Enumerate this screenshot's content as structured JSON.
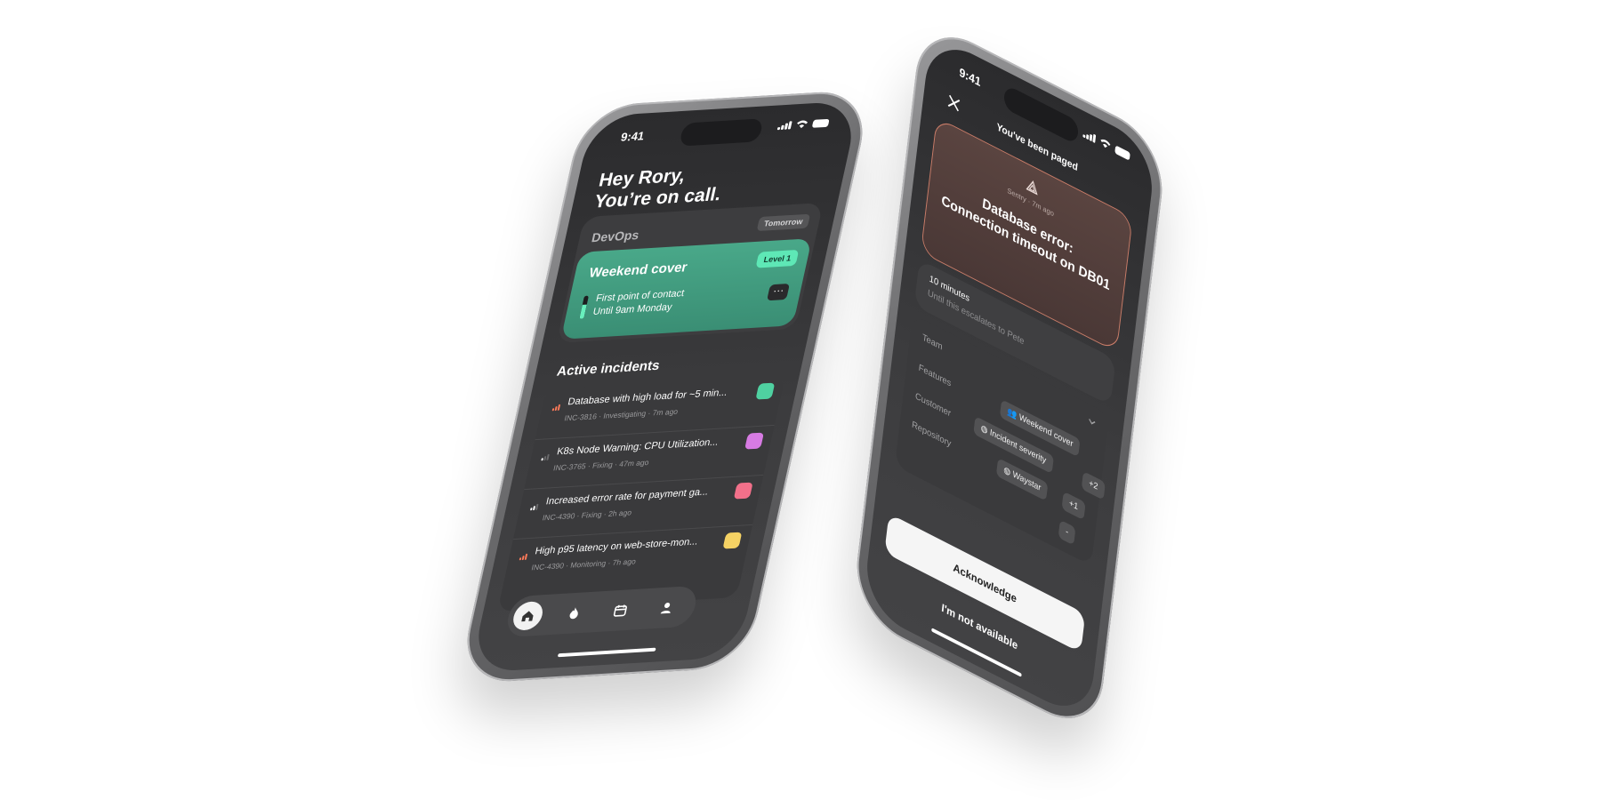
{
  "phone_one": {
    "status": {
      "time": "9:41"
    },
    "greeting": {
      "line1": "Hey Rory,",
      "line2": "You’re on call."
    },
    "team": {
      "name": "DevOps",
      "badge": "Tomorrow"
    },
    "cover": {
      "title": "Weekend cover",
      "level": "Level 1",
      "line1": "First point of contact",
      "line2": "Until 9am Monday",
      "more": "···",
      "progress": 0.6,
      "accent": "#49a889"
    },
    "incidents_title": "Active incidents",
    "incidents": [
      {
        "title": "Database with high load for ~5 min...",
        "meta": "INC-3816 · Investigating · 7m ago",
        "severity": 3,
        "sev_color": "#ff7a59",
        "avatar_color": "#4fd1a1"
      },
      {
        "title": "K8s Node Warning: CPU Utilization...",
        "meta": "INC-3765 · Fixing · 47m ago",
        "severity": 1,
        "sev_color": "#ffffff",
        "avatar_color": "#d77be3"
      },
      {
        "title": "Increased error rate for payment ga...",
        "meta": "INC-4390 · Fixing · 2h ago",
        "severity": 2,
        "sev_color": "#ffffff",
        "avatar_color": "#f2708a"
      },
      {
        "title": "High p95 latency on web-store-mon...",
        "meta": "INC-4390 · Monitoring · 7h ago",
        "severity": 3,
        "sev_color": "#ff7a59",
        "avatar_color": "#f5d264"
      }
    ],
    "tabs": [
      {
        "name": "home-icon",
        "active": true
      },
      {
        "name": "fire-icon",
        "active": false
      },
      {
        "name": "calendar-icon",
        "active": false
      },
      {
        "name": "profile-icon",
        "active": false
      }
    ]
  },
  "phone_two": {
    "status": {
      "time": "9:41"
    },
    "header": "You've been paged",
    "alert": {
      "source": "Sentry · 7m ago",
      "title_line1": "Database error:",
      "title_line2": "Connection timeout on DB01",
      "border_color": "#c97c68"
    },
    "escalation": {
      "time": "10 minutes",
      "note": "Until this escalates to Pete"
    },
    "fields": {
      "team_label": "Team",
      "features_label": "Features",
      "customer_label": "Customer",
      "repository_label": "Repository",
      "chips": {
        "weekend_cover": "Weekend cover",
        "incident_severity": "Incident severity",
        "plus_two": "+2",
        "waystar": "Waystar",
        "plus_one": "+1",
        "dash": "-"
      }
    },
    "actions": {
      "acknowledge": "Acknowledge",
      "not_available": "I'm not available"
    }
  }
}
